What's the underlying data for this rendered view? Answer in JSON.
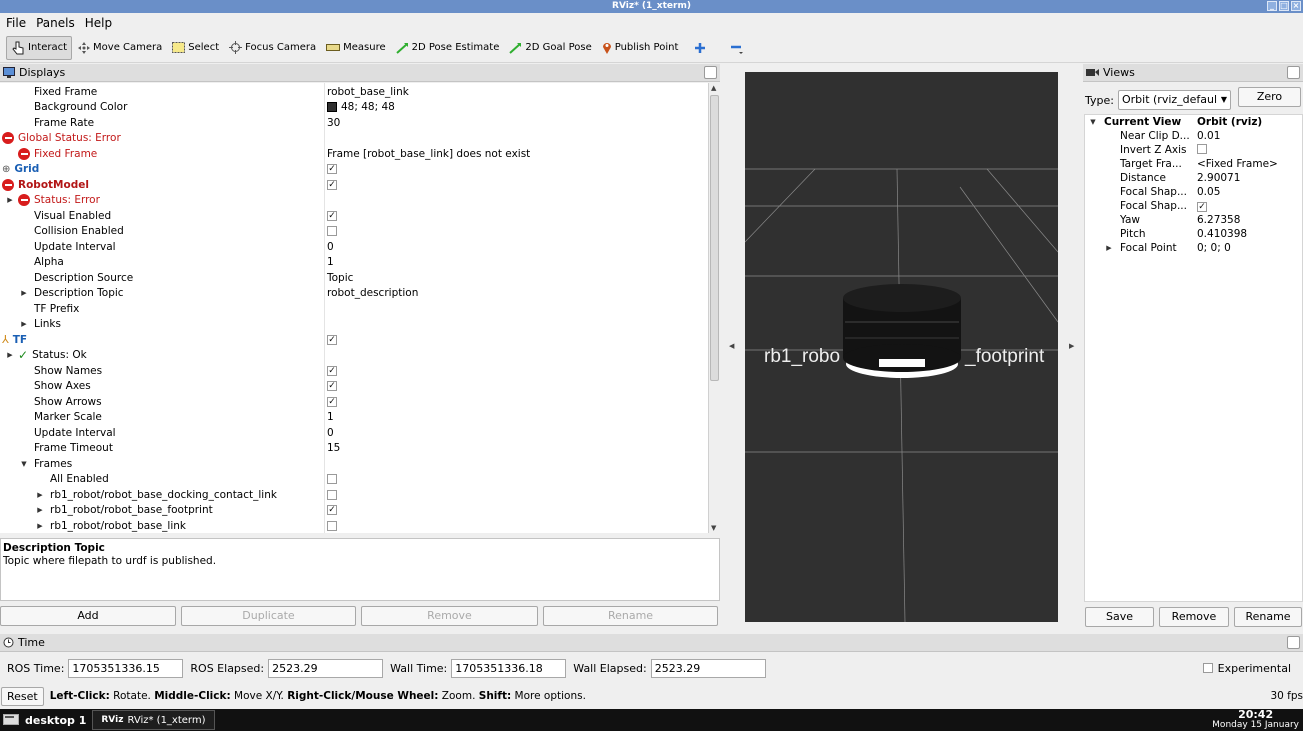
{
  "window": {
    "title": "RViz* (1_xterm)"
  },
  "menu": [
    "File",
    "Panels",
    "Help"
  ],
  "toolbar": [
    {
      "label": "Interact",
      "icon": "hand-pointer-icon",
      "active": true
    },
    {
      "label": "Move Camera",
      "icon": "move-arrows-icon"
    },
    {
      "label": "Select",
      "icon": "select-rectangle-icon"
    },
    {
      "label": "Focus Camera",
      "icon": "focus-crosshair-icon"
    },
    {
      "label": "Measure",
      "icon": "ruler-icon"
    },
    {
      "label": "2D Pose Estimate",
      "icon": "green-arrow-icon"
    },
    {
      "label": "2D Goal Pose",
      "icon": "green-arrow-icon"
    },
    {
      "label": "Publish Point",
      "icon": "map-pin-icon"
    }
  ],
  "displays": {
    "title": "Displays",
    "rows": [
      {
        "name": "Fixed Frame",
        "value": "robot_base_link",
        "indent": 34
      },
      {
        "name": "Background Color",
        "value": "48; 48; 48",
        "swatch": "#303030",
        "indent": 34
      },
      {
        "name": "Frame Rate",
        "value": "30",
        "indent": 34
      },
      {
        "name": "Global Status: Error",
        "arrow": "open",
        "icon": "error",
        "style": "err",
        "indent": 18
      },
      {
        "name": "Fixed Frame",
        "value": "Frame [robot_base_link] does not exist",
        "icon": "error",
        "style": "err",
        "indent": 34
      },
      {
        "name": "Grid",
        "arrow": "closed",
        "icon": "grid",
        "style": "blue",
        "check": true,
        "indent": 18
      },
      {
        "name": "RobotModel",
        "arrow": "open",
        "icon": "error",
        "style": "redb",
        "check": true,
        "indent": 18
      },
      {
        "name": "Status: Error",
        "arrow": "closed",
        "icon": "error",
        "style": "err",
        "indent": 34
      },
      {
        "name": "Visual Enabled",
        "check": true,
        "indent": 34
      },
      {
        "name": "Collision Enabled",
        "check": false,
        "indent": 34
      },
      {
        "name": "Update Interval",
        "value": "0",
        "indent": 34
      },
      {
        "name": "Alpha",
        "value": "1",
        "indent": 34
      },
      {
        "name": "Description Source",
        "value": "Topic",
        "indent": 34
      },
      {
        "name": "Description Topic",
        "value": "robot_description",
        "arrow": "closed",
        "indent": 34
      },
      {
        "name": "TF Prefix",
        "indent": 34
      },
      {
        "name": "Links",
        "arrow": "closed",
        "indent": 34
      },
      {
        "name": "TF",
        "arrow": "open",
        "icon": "tf",
        "style": "blue",
        "check": true,
        "indent": 18
      },
      {
        "name": "Status: Ok",
        "arrow": "closed",
        "icon": "ok",
        "indent": 34
      },
      {
        "name": "Show Names",
        "check": true,
        "indent": 34
      },
      {
        "name": "Show Axes",
        "check": true,
        "indent": 34
      },
      {
        "name": "Show Arrows",
        "check": true,
        "indent": 34
      },
      {
        "name": "Marker Scale",
        "value": "1",
        "indent": 34
      },
      {
        "name": "Update Interval",
        "value": "0",
        "indent": 34
      },
      {
        "name": "Frame Timeout",
        "value": "15",
        "indent": 34
      },
      {
        "name": "Frames",
        "arrow": "open",
        "indent": 34
      },
      {
        "name": "All Enabled",
        "check": false,
        "indent": 50
      },
      {
        "name": "rb1_robot/robot_base_docking_contact_link",
        "arrow": "closed",
        "check": false,
        "indent": 50
      },
      {
        "name": "rb1_robot/robot_base_footprint",
        "arrow": "closed",
        "check": true,
        "indent": 50
      },
      {
        "name": "rb1_robot/robot_base_link",
        "arrow": "closed",
        "check": false,
        "indent": 50
      }
    ],
    "description_title": "Description Topic",
    "description_text": "Topic where filepath to urdf is published.",
    "buttons": [
      {
        "label": "Add",
        "enabled": true
      },
      {
        "label": "Duplicate",
        "enabled": false
      },
      {
        "label": "Remove",
        "enabled": false
      },
      {
        "label": "Rename",
        "enabled": false
      }
    ]
  },
  "view3d": {
    "label_left": "rb1_robo",
    "label_right": "_footprint",
    "background": "#303030"
  },
  "views": {
    "title": "Views",
    "type_label": "Type:",
    "type_value": "Orbit (rviz_defaul",
    "zero_button": "Zero",
    "header": {
      "name": "Current View",
      "value": "Orbit (rviz)"
    },
    "rows": [
      {
        "name": "Near Clip D...",
        "value": "0.01"
      },
      {
        "name": "Invert Z Axis",
        "check": false
      },
      {
        "name": "Target Fra...",
        "value": "<Fixed Frame>"
      },
      {
        "name": "Distance",
        "value": "2.90071"
      },
      {
        "name": "Focal Shap...",
        "value": "0.05"
      },
      {
        "name": "Focal Shap...",
        "check": true
      },
      {
        "name": "Yaw",
        "value": "6.27358"
      },
      {
        "name": "Pitch",
        "value": "0.410398"
      },
      {
        "name": "Focal Point",
        "value": "0; 0; 0",
        "arrow": true
      }
    ],
    "buttons": [
      "Save",
      "Remove",
      "Rename"
    ]
  },
  "time": {
    "title": "Time",
    "ros_time_label": "ROS Time:",
    "ros_time": "1705351336.15",
    "ros_elapsed_label": "ROS Elapsed:",
    "ros_elapsed": "2523.29",
    "wall_time_label": "Wall Time:",
    "wall_time": "1705351336.18",
    "wall_elapsed_label": "Wall Elapsed:",
    "wall_elapsed": "2523.29",
    "experimental": "Experimental"
  },
  "status": {
    "reset": "Reset",
    "parts": [
      {
        "b": "Left-Click:",
        "t": " Rotate. "
      },
      {
        "b": "Middle-Click:",
        "t": " Move X/Y. "
      },
      {
        "b": "Right-Click/Mouse Wheel:",
        "t": " Zoom. "
      },
      {
        "b": "Shift:",
        "t": " More options."
      }
    ],
    "fps": "30 fps"
  },
  "taskbar": {
    "desktop": "desktop 1",
    "task": "RViz* (1_xterm)",
    "time": "20:42",
    "date": "Monday 15 January"
  }
}
